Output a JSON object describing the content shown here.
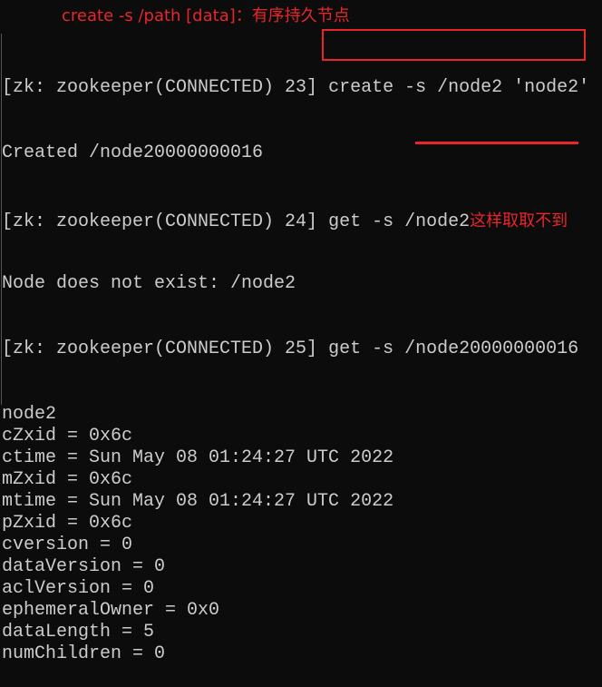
{
  "annotation": {
    "caption": "create -s /path [data]：有序持久节点",
    "note": "这样取取不到",
    "accent": "#e8262b"
  },
  "terminal": {
    "prompt23": "[zk: zookeeper(CONNECTED) 23] ",
    "cmd23": "create -s /node2 'node2'",
    "out1": "Created /node20000000016",
    "prompt24": "[zk: zookeeper(CONNECTED) 24] ",
    "cmd24": "get -s /node2",
    "out2": "Node does not exist: /node2",
    "prompt25": "[zk: zookeeper(CONNECTED) 25] ",
    "cmd25_prefix": "get -s /",
    "cmd25_node": "node20000000016",
    "stats": [
      "node2",
      "cZxid = 0x6c",
      "ctime = Sun May 08 01:24:27 UTC 2022",
      "mZxid = 0x6c",
      "mtime = Sun May 08 01:24:27 UTC 2022",
      "pZxid = 0x6c",
      "cversion = 0",
      "dataVersion = 0",
      "aclVersion = 0",
      "ephemeralOwner = 0x0",
      "dataLength = 5",
      "numChildren = 0"
    ]
  }
}
